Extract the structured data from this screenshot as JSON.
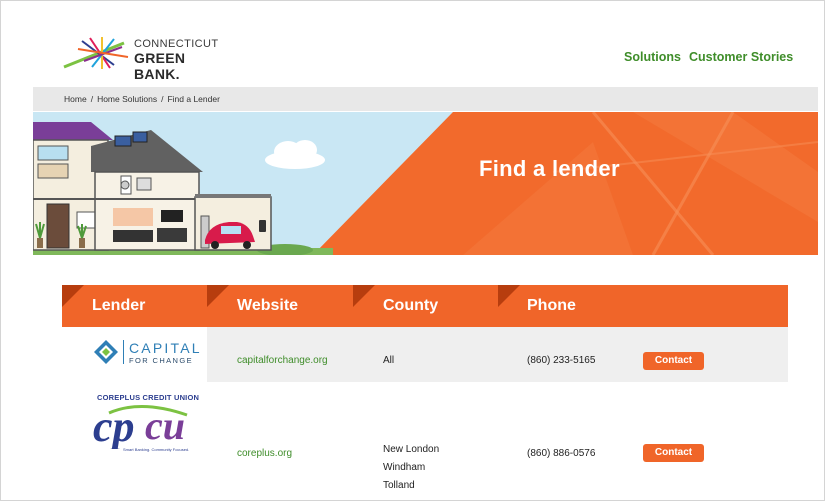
{
  "brand": {
    "line1": "CONNECTICUT",
    "line2": "GREEN BANK."
  },
  "nav": {
    "solutions": "Solutions",
    "stories": "Customer Stories"
  },
  "breadcrumb": {
    "home": "Home",
    "home_solutions": "Home Solutions",
    "current": "Find a Lender",
    "separator": "/"
  },
  "hero": {
    "title": "Find a lender"
  },
  "table": {
    "headers": [
      "Lender",
      "Website",
      "County",
      "Phone"
    ],
    "rows": [
      {
        "lender_logo_text": "CAPITAL",
        "lender_logo_subtext": "FOR CHANGE",
        "website": "capitalforchange.org",
        "county": [
          "All"
        ],
        "phone": "(860) 233-5165",
        "action": "Contact"
      },
      {
        "lender_logo_text": "COREPLUS CREDIT UNION",
        "lender_logo_subtext": "Smart Banking. Community Focused.",
        "website": "coreplus.org",
        "county": [
          "New London",
          "Windham",
          "Tolland"
        ],
        "phone": "(860) 886-0576",
        "action": "Contact"
      }
    ]
  },
  "colors": {
    "accent": "#f06529",
    "green": "#3f8d2a",
    "sky": "#c6e6f3"
  }
}
